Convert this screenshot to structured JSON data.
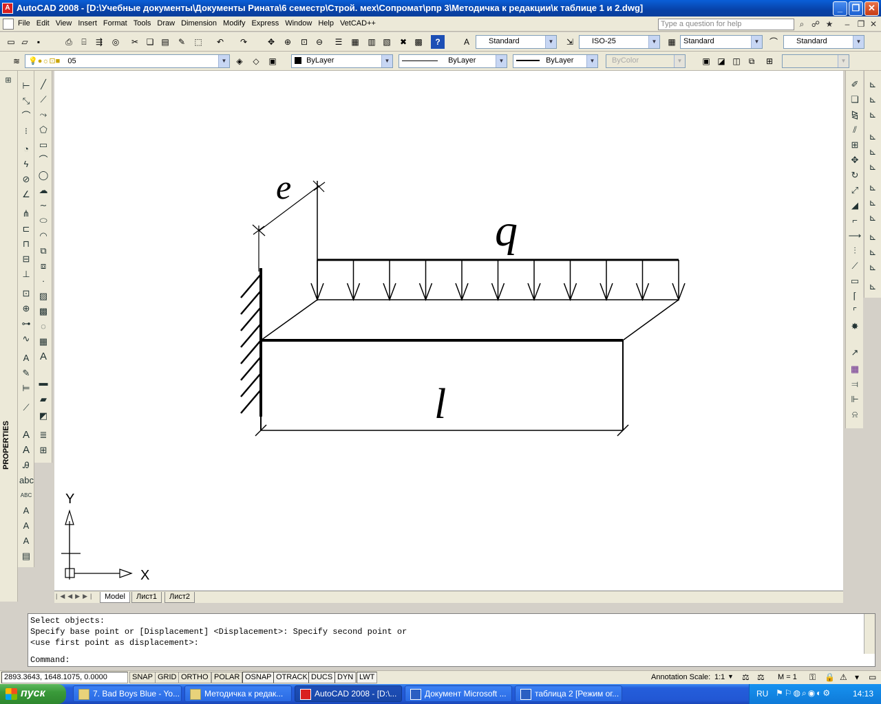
{
  "window": {
    "title": "AutoCAD 2008 - [D:\\Учебные документы\\Документы Рината\\6 семестр\\Строй. мех\\Сопромат\\рпр 3\\Методичка к редакции\\к таблице 1 и 2.dwg]",
    "app_icon": "A"
  },
  "menu": {
    "items": [
      "File",
      "Edit",
      "View",
      "Insert",
      "Format",
      "Tools",
      "Draw",
      "Dimension",
      "Modify",
      "Express",
      "Window",
      "Help",
      "VetCAD++"
    ],
    "help_placeholder": "Type a question for help"
  },
  "styles_toolbar": {
    "text_style": "Standard",
    "dim_style": "ISO-25",
    "table_style": "Standard",
    "mleader_style": "Standard"
  },
  "layers_toolbar": {
    "current_layer": "05",
    "color": "ByLayer",
    "linetype": "ByLayer",
    "lineweight": "ByLayer",
    "plot_style": "ByColor"
  },
  "drawing": {
    "label_e": "e",
    "label_q": "q",
    "label_l": "l",
    "ucs_x": "X",
    "ucs_y": "Y"
  },
  "layout_tabs": [
    "Model",
    "Лист1",
    "Лист2"
  ],
  "properties_label": "PROPERTIES",
  "command": {
    "lines": [
      "Select objects:",
      "Specify base point or [Displacement] <Displacement>: Specify second point or",
      "<use first point as displacement>:"
    ],
    "prompt": "Command:"
  },
  "status": {
    "coords": "2893.3643, 1648.1075, 0.0000",
    "toggles": [
      {
        "label": "SNAP",
        "on": false
      },
      {
        "label": "GRID",
        "on": false
      },
      {
        "label": "ORTHO",
        "on": false
      },
      {
        "label": "POLAR",
        "on": false
      },
      {
        "label": "OSNAP",
        "on": true
      },
      {
        "label": "OTRACK",
        "on": true
      },
      {
        "label": "DUCS",
        "on": true
      },
      {
        "label": "DYN",
        "on": true
      },
      {
        "label": "LWT",
        "on": true
      }
    ],
    "annotation_scale_label": "Annotation Scale:",
    "annotation_scale": "1:1",
    "m_value": "M = 1"
  },
  "taskbar": {
    "start": "пуск",
    "tasks": [
      {
        "label": "7. Bad Boys Blue - Yo...",
        "active": false
      },
      {
        "label": "Методичка к редак...",
        "active": false
      },
      {
        "label": "AutoCAD 2008 - [D:\\...",
        "active": true
      },
      {
        "label": "Документ Microsoft ...",
        "active": false
      },
      {
        "label": "таблица 2 [Режим ог...",
        "active": false
      }
    ],
    "lang": "RU",
    "time": "14:13"
  }
}
